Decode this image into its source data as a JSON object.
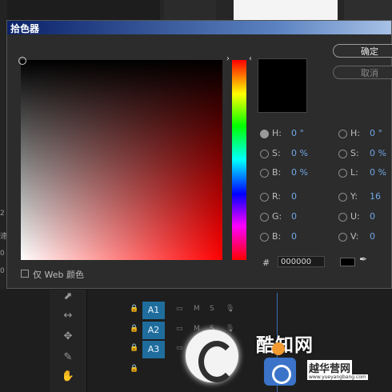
{
  "dialog": {
    "title": "拾色器",
    "ok_label": "确定",
    "cancel_label": "取消",
    "hex_symbol": "#",
    "hex_value": "000000",
    "web_only_label": "仅 Web 颜色",
    "fields": [
      {
        "label": "H:",
        "value": "0 °",
        "selected": true
      },
      {
        "label": "S:",
        "value": "0 %",
        "selected": false
      },
      {
        "label": "B:",
        "value": "0 %",
        "selected": false
      },
      {
        "label": "R:",
        "value": "0",
        "selected": false
      },
      {
        "label": "G:",
        "value": "0",
        "selected": false
      },
      {
        "label": "B:",
        "value": "0",
        "selected": false
      },
      {
        "label": "H:",
        "value": "0 °",
        "selected": false
      },
      {
        "label": "S:",
        "value": "0 %",
        "selected": false
      },
      {
        "label": "L:",
        "value": "0 %",
        "selected": false
      },
      {
        "label": "Y:",
        "value": "16",
        "selected": false
      },
      {
        "label": "U:",
        "value": "0",
        "selected": false
      },
      {
        "label": "V:",
        "value": "0",
        "selected": false
      }
    ],
    "current_color": "#000000",
    "hue_color": "#ff0000"
  },
  "background": {
    "tracks": [
      "A1",
      "A2",
      "A3"
    ],
    "track_controls": [
      "M",
      "S"
    ],
    "logo_text": "酷知网",
    "logo_sub": "越华营网",
    "logo_url": "www.yueyangbang.com",
    "left_edge_chars": [
      "2",
      "速",
      "0",
      "0"
    ]
  }
}
